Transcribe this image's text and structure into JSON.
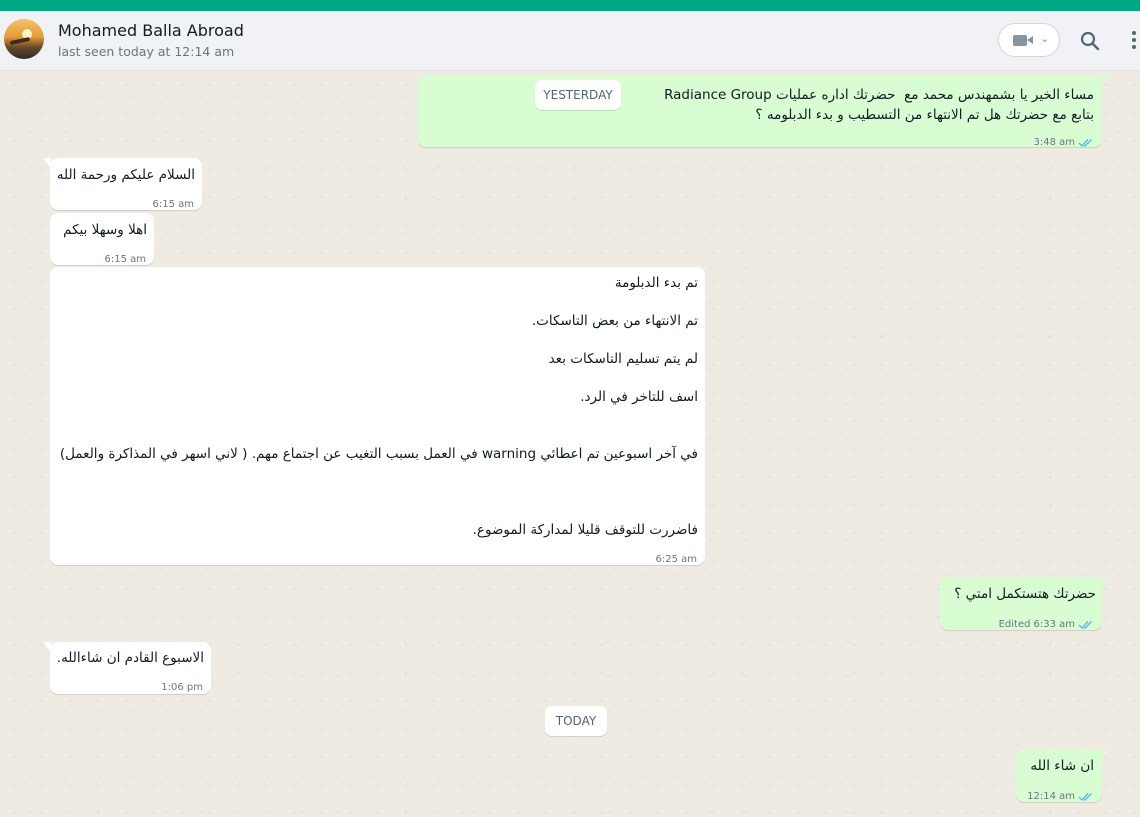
{
  "header": {
    "contact_name": "Mohamed Balla Abroad",
    "status": "last seen today at 12:14 am",
    "icons": {
      "video": "video-camera-icon",
      "search": "search-icon",
      "menu": "more-vertical-icon"
    }
  },
  "dates": {
    "yesterday": "YESTERDAY",
    "today": "TODAY"
  },
  "messages": [
    {
      "dir": "out",
      "lines": [
        "مساء الخير يا بشمهندس محمد مع  حضرتك اداره عمليات Radiance Group",
        "بتابع مع حضرتك هل تم الانتهاء من التسطيب و بدء الدبلومه ؟"
      ],
      "time": "3:48 am",
      "status": "read"
    },
    {
      "dir": "in",
      "lines": [
        "السلام عليكم ورحمة الله"
      ],
      "time": "6:15 am"
    },
    {
      "dir": "in",
      "lines": [
        "اهلا وسهلا بيكم"
      ],
      "time": "6:15 am"
    },
    {
      "dir": "in",
      "lines": [
        "تم بدء الدبلومة",
        "تم الانتهاء من بعض التاسكات.",
        "لم يتم تسليم التاسكات بعد",
        "اسف للتاخر في الرد.",
        "في آخر اسبوعين تم اعطائي warning في العمل بسبب التغيب عن اجتماع مهم. ( لاني اسهر في المذاكرة والعمل)",
        "فاضررت للتوقف قليلا لمداركة الموضوع."
      ],
      "time": "6:25 am"
    },
    {
      "dir": "out",
      "lines": [
        "حضرتك هتستكمل امتي ؟"
      ],
      "edited": "Edited",
      "time": "6:33 am",
      "status": "read"
    },
    {
      "dir": "in",
      "lines": [
        "الاسبوع القادم ان شاءالله."
      ],
      "time": "1:06 pm"
    },
    {
      "dir": "out",
      "lines": [
        "ان شاء الله"
      ],
      "time": "12:14 am",
      "status": "read"
    }
  ],
  "colors": {
    "accent": "#00a884",
    "outgoing_bubble": "#d9fdd3",
    "incoming_bubble": "#ffffff",
    "read_ticks": "#53bdeb",
    "background": "#efeae2"
  }
}
